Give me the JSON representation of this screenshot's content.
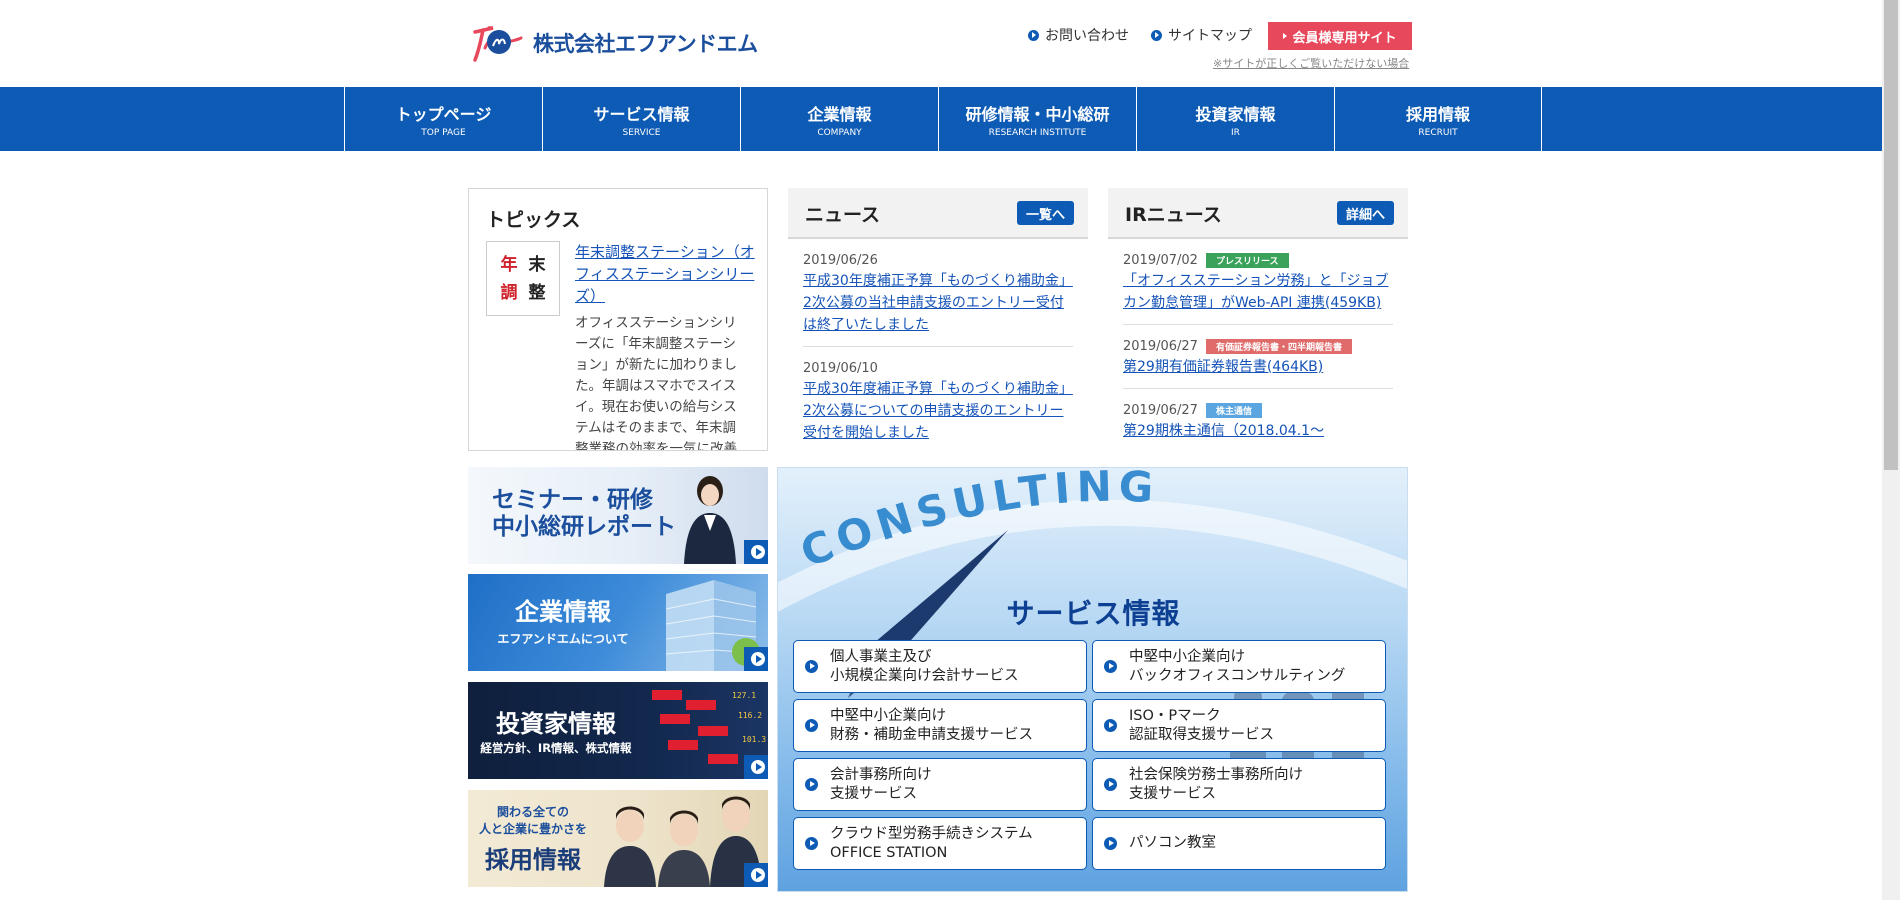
{
  "header": {
    "company_name": "株式会社エフアンドエム",
    "links": [
      {
        "label": "お問い合わせ",
        "icon": "arrow-circle-icon"
      },
      {
        "label": "サイトマップ",
        "icon": "arrow-circle-icon"
      }
    ],
    "member_button": "会員様専用サイト",
    "display_note": "※サイトが正しくご覧いただけない場合",
    "accent_color": "#e8485c"
  },
  "nav": {
    "color": "#0d5bb5",
    "items": [
      {
        "jp": "トップページ",
        "en": "TOP PAGE"
      },
      {
        "jp": "サービス情報",
        "en": "SERVICE"
      },
      {
        "jp": "企業情報",
        "en": "COMPANY"
      },
      {
        "jp": "研修情報・中小総研",
        "en": "RESEARCH INSTITUTE"
      },
      {
        "jp": "投資家情報",
        "en": "IR"
      },
      {
        "jp": "採用情報",
        "en": "RECRUIT"
      }
    ]
  },
  "topics": {
    "title": "トピックス",
    "thumb_chars": [
      "年",
      "末",
      "調",
      "整"
    ],
    "link": "年末調整ステーション（オフィスステーションシリーズ）",
    "body": "オフィスステーションシリーズに「年末調整ステーション」が新たに加わりました。年調はスマホでスイスイ。現在お使いの給与システムはそのままで、年末調整業務の効率を一気に改善"
  },
  "news": {
    "title": "ニュース",
    "more": "一覧へ",
    "items": [
      {
        "date": "2019/06/26",
        "title": "平成30年度補正予算「ものづくり補助金」2次公募の当社申請支援のエントリー受付は終了いたしました"
      },
      {
        "date": "2019/06/10",
        "title": "平成30年度補正予算「ものづくり補助金」2次公募についての申請支援のエントリー受付を開始しました"
      }
    ]
  },
  "ir_news": {
    "title": "IRニュース",
    "more": "詳細へ",
    "items": [
      {
        "date": "2019/07/02",
        "tag": "プレスリリース",
        "tag_color": "#3aa25b",
        "title": "「オフィスステーション労務」と「ジョブカン勤怠管理」がWeb-API 連携(459KB)"
      },
      {
        "date": "2019/06/27",
        "tag": "有価証券報告書・四半期報告書",
        "tag_color": "#e06b6b",
        "title": "第29期有価証券報告書(464KB)"
      },
      {
        "date": "2019/06/27",
        "tag": "株主通信",
        "tag_color": "#5ba6e0",
        "title": "第29期株主通信（2018.04.1～"
      }
    ]
  },
  "banners": {
    "seminar": {
      "line1": "セミナー・研修",
      "line2": "中小総研レポート"
    },
    "company": {
      "title": "企業情報",
      "sub": "エフアンドエムについて"
    },
    "investor": {
      "title": "投資家情報",
      "sub": "経営方針、IR情報、株式情報"
    },
    "recruit": {
      "sub_line1": "関わる全ての",
      "sub_line2": "人と企業に豊かさを",
      "title": "採用情報"
    }
  },
  "consulting": {
    "bg_word": "CONSULTING",
    "title": "サービス情報",
    "services": [
      {
        "line1": "個人事業主及び",
        "line2": "小規模企業向け会計サービス"
      },
      {
        "line1": "中堅中小企業向け",
        "line2": "バックオフィスコンサルティング"
      },
      {
        "line1": "中堅中小企業向け",
        "line2": "財務・補助金申請支援サービス"
      },
      {
        "line1": "ISO・Pマーク",
        "line2": "認証取得支援サービス"
      },
      {
        "line1": "会計事務所向け",
        "line2": "支援サービス"
      },
      {
        "line1": "社会保険労務士事務所向け",
        "line2": "支援サービス"
      },
      {
        "line1": "クラウド型労務手続きシステム",
        "line2": "OFFICE STATION"
      },
      {
        "line1": "パソコン教室",
        "line2": ""
      }
    ]
  }
}
